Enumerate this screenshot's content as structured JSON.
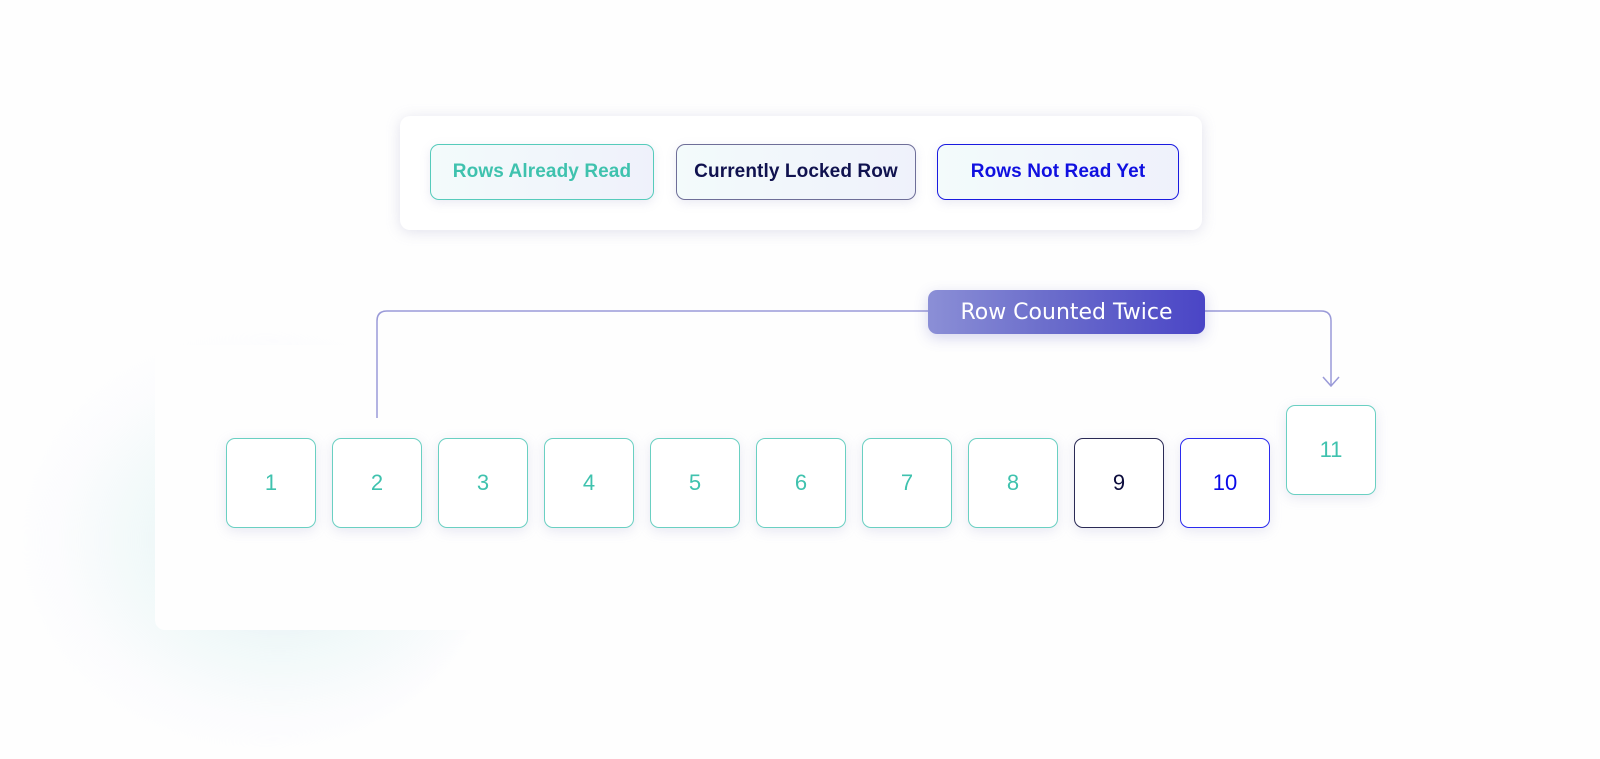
{
  "legend": {
    "items": [
      {
        "key": "read",
        "label": "Rows Already Read",
        "color": "#3fc2ae"
      },
      {
        "key": "locked",
        "label": "Currently Locked Row",
        "color": "#10124f"
      },
      {
        "key": "unread",
        "label": "Rows Not Read Yet",
        "color": "#1010e0"
      }
    ]
  },
  "annotation": {
    "label": "Row Counted Twice",
    "from_row": "2",
    "to_row": "11",
    "line_color": "#9a9ad8"
  },
  "rows": [
    {
      "label": "1",
      "state": "read"
    },
    {
      "label": "2",
      "state": "read"
    },
    {
      "label": "3",
      "state": "read"
    },
    {
      "label": "4",
      "state": "read"
    },
    {
      "label": "5",
      "state": "read"
    },
    {
      "label": "6",
      "state": "read"
    },
    {
      "label": "7",
      "state": "read"
    },
    {
      "label": "8",
      "state": "read"
    },
    {
      "label": "9",
      "state": "locked"
    },
    {
      "label": "10",
      "state": "unread"
    },
    {
      "label": "11",
      "state": "read"
    }
  ]
}
